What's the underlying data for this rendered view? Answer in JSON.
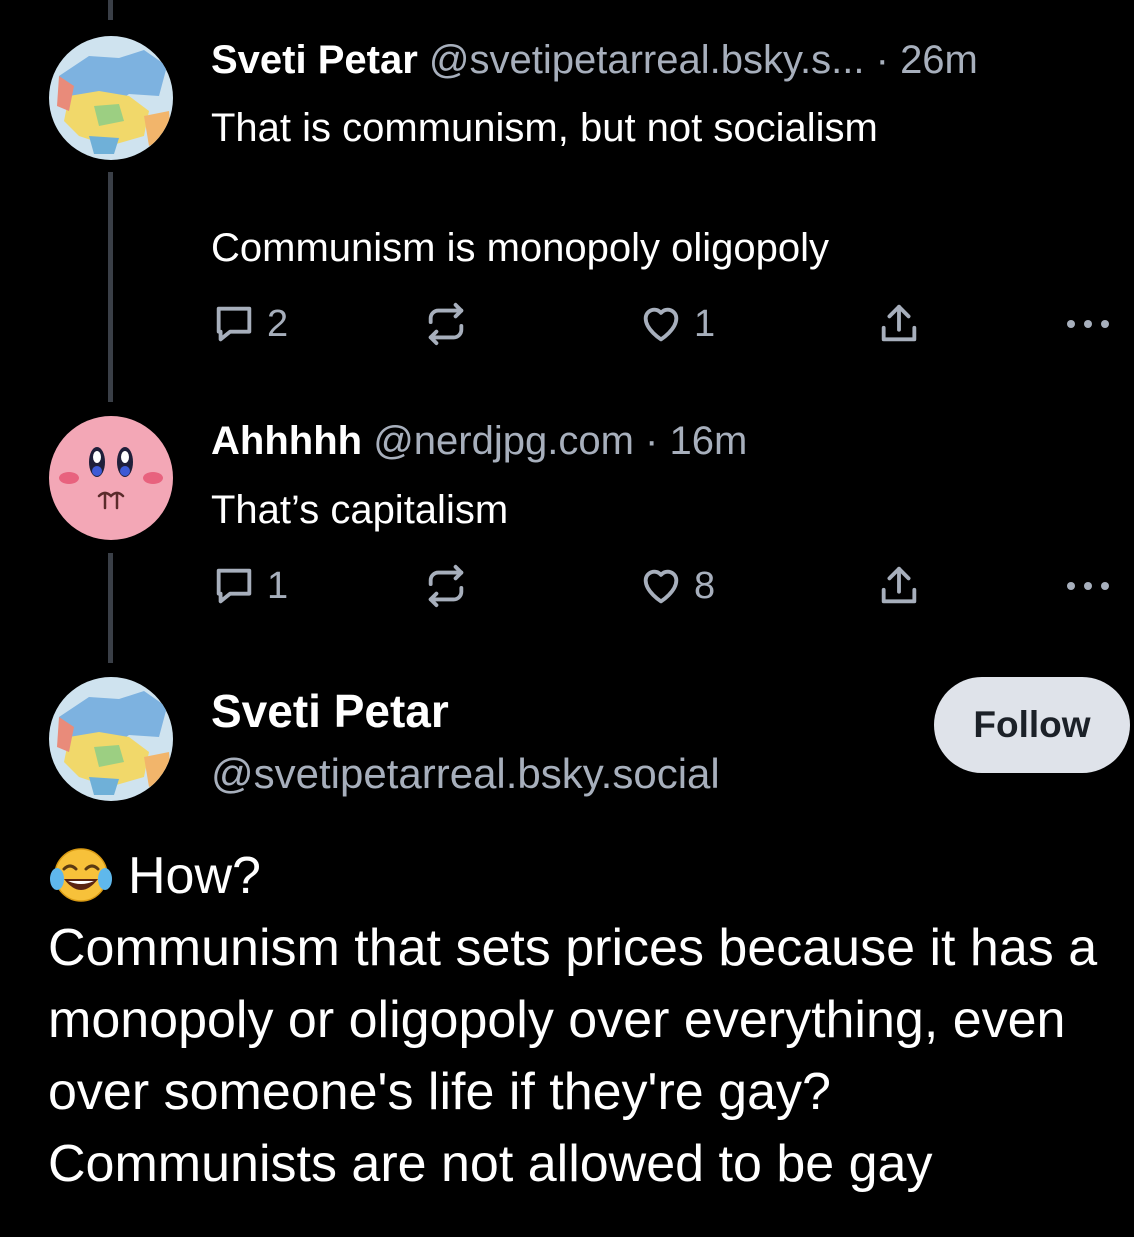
{
  "posts": [
    {
      "name": "Sveti Petar",
      "handle": "@svetipetarreal.bsky.s...",
      "sep": "·",
      "time": "26m",
      "text": "That is communism, but not socialism\n\nCommunism is monopoly oligopoly",
      "reply_count": "2",
      "repost_count": "",
      "like_count": "1",
      "avatar_icon": "map-avatar-icon"
    },
    {
      "name": "Ahhhhh",
      "handle": "@nerdjpg.com",
      "sep": "·",
      "time": "16m",
      "text": "That’s capitalism",
      "reply_count": "1",
      "repost_count": "",
      "like_count": "8",
      "avatar_icon": "kirby-avatar-icon"
    }
  ],
  "main_post": {
    "name": "Sveti Petar",
    "handle": "@svetipetarreal.bsky.social",
    "follow_label": "Follow",
    "emoji": "face-with-tears-of-joy-icon",
    "line1": "How?",
    "line2": "Communism that sets prices because it has a monopoly or oligopoly over everything, even over someone's life if they're gay?",
    "line3": "Communists are not allowed to be gay"
  },
  "colors": {
    "background": "#000000",
    "muted_text": "#a7afbc",
    "thread_line": "#3a3f47",
    "follow_bg": "#dfe3ea"
  }
}
